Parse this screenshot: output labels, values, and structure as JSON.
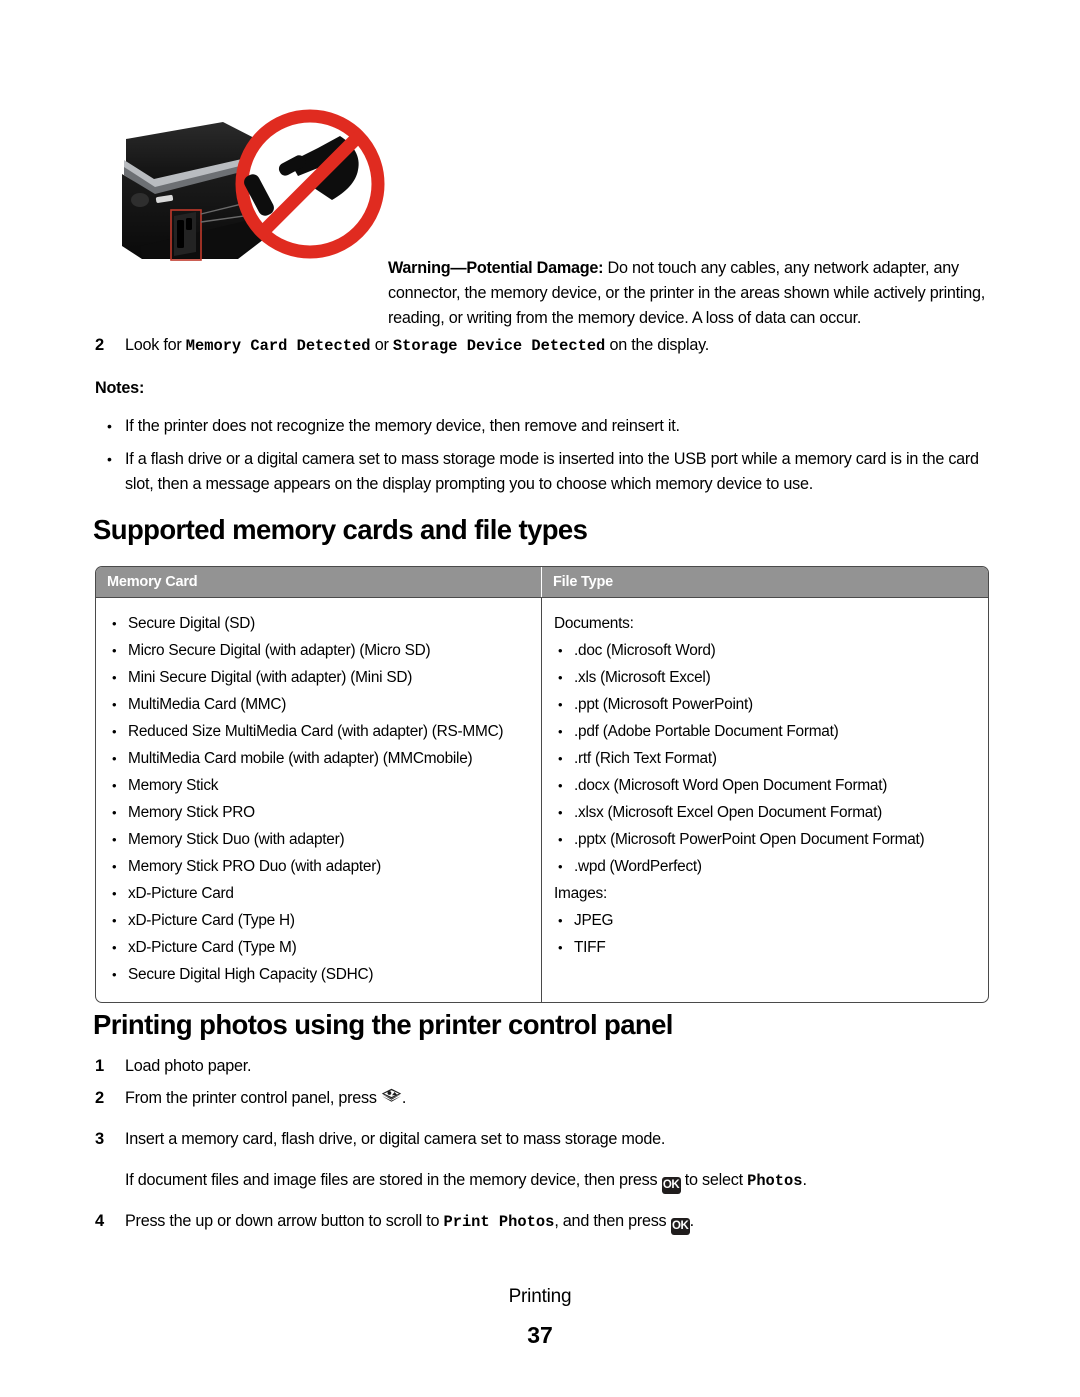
{
  "illustration": {
    "alt": "Printer memory card slot area with a red no-touch prohibition symbol showing a hand",
    "prohibition_color": "#e02b20",
    "printer_body_color": "#181818"
  },
  "warning": {
    "label": "Warning—Potential Damage:",
    "text": " Do not touch any cables, any network adapter, any connector, the memory device, or the printer in the areas shown while actively printing, reading, or writing from the memory device. A loss of data can occur."
  },
  "step_detect": {
    "number": "2",
    "text_before": "Look for ",
    "code_1": "Memory Card Detected",
    "text_mid": " or ",
    "code_2": "Storage Device Detected",
    "text_after": " on the display."
  },
  "notes": {
    "label": "Notes:",
    "items": [
      "If the printer does not recognize the memory device, then remove and reinsert it.",
      "If a flash drive or a digital camera set to mass storage mode is inserted into the USB port while a memory card is in the card slot, then a message appears on the display prompting you to choose which memory device to use."
    ]
  },
  "headings": {
    "memory_cards": "Supported memory cards and file types",
    "printing_photos": "Printing photos using the printer control panel"
  },
  "table": {
    "header_bg": "#939393",
    "columns": [
      "Memory Card",
      "File Type"
    ],
    "memory_cards": [
      "Secure Digital (SD)",
      "Micro Secure Digital (with adapter) (Micro SD)",
      "Mini Secure Digital (with adapter) (Mini SD)",
      "MultiMedia Card (MMC)",
      "Reduced Size MultiMedia Card (with adapter) (RS-MMC)",
      "MultiMedia Card mobile (with adapter) (MMCmobile)",
      "Memory Stick",
      "Memory Stick PRO",
      "Memory Stick Duo (with adapter)",
      "Memory Stick PRO Duo (with adapter)",
      "xD-Picture Card",
      "xD-Picture Card (Type H)",
      "xD-Picture Card (Type M)",
      "Secure Digital High Capacity (SDHC)"
    ],
    "file_types": {
      "documents_label": "Documents:",
      "documents": [
        ".doc (Microsoft Word)",
        ".xls (Microsoft Excel)",
        ".ppt (Microsoft PowerPoint)",
        ".pdf (Adobe Portable Document Format)",
        ".rtf (Rich Text Format)",
        ".docx (Microsoft Word Open Document Format)",
        ".xlsx (Microsoft Excel Open Document Format)",
        ".pptx (Microsoft PowerPoint Open Document Format)",
        ".wpd (WordPerfect)"
      ],
      "images_label": "Images:",
      "images": [
        "JPEG",
        "TIFF"
      ]
    }
  },
  "print_steps": {
    "s1": {
      "number": "1",
      "text": "Load photo paper."
    },
    "s2": {
      "number": "2",
      "text_before": "From the printer control panel, press ",
      "icon": "photo-card-icon",
      "text_after": "."
    },
    "s3": {
      "number": "3",
      "text": "Insert a memory card, flash drive, or digital camera set to mass storage mode.",
      "sub_before": "If document files and image files are stored in the memory device, then press ",
      "sub_icon_label": "OK",
      "sub_mid": " to select ",
      "sub_code": "Photos",
      "sub_after": "."
    },
    "s4": {
      "number": "4",
      "text_before": "Press the up or down arrow button to scroll to ",
      "code": "Print Photos",
      "text_mid": ", and then press ",
      "icon_label": "OK",
      "text_after": "."
    }
  },
  "footer": {
    "section": "Printing",
    "page_number": "37"
  }
}
